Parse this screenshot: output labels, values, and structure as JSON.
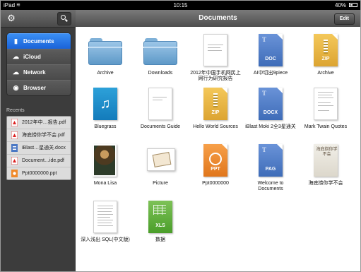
{
  "status_bar": {
    "carrier": "iPad",
    "time": "10:15",
    "battery": "40%"
  },
  "sidebar": {
    "nav": [
      {
        "label": "Documents",
        "icon": "document-icon",
        "active": true
      },
      {
        "label": "iCloud",
        "icon": "cloud-icon",
        "active": false
      },
      {
        "label": "Network",
        "icon": "network-cloud-icon",
        "active": false
      },
      {
        "label": "Browser",
        "icon": "compass-icon",
        "active": false
      }
    ],
    "recents_label": "Recents",
    "recents": [
      {
        "label": "2012年中…报告.pdf",
        "type": "pdf"
      },
      {
        "label": "海底捞你学不会.pdf",
        "type": "pdf"
      },
      {
        "label": "iBlast…星通关.docx",
        "type": "docx"
      },
      {
        "label": "Document…ide.pdf",
        "type": "pdf"
      },
      {
        "label": "Ppt0000000.ppt",
        "type": "ppt"
      }
    ]
  },
  "header": {
    "title": "Documents",
    "edit_label": "Edit"
  },
  "files": [
    {
      "name": "Archive",
      "kind": "folder"
    },
    {
      "name": "Downloads",
      "kind": "folder"
    },
    {
      "name": "2012年中国手机网民上网行为研究报告",
      "kind": "paper"
    },
    {
      "name": "AI中切出9piece",
      "kind": "doc",
      "badge": "DOC",
      "color": "#4a78c4"
    },
    {
      "name": "Archive",
      "kind": "zip",
      "badge": "ZIP",
      "color": "#e6b53a"
    },
    {
      "name": "Bluegrass",
      "kind": "music"
    },
    {
      "name": "Documents Guide",
      "kind": "paper"
    },
    {
      "name": "Hello World Sources",
      "kind": "zip",
      "badge": "ZIP",
      "color": "#e6b53a"
    },
    {
      "name": "iBlast Moki 2全3星通关",
      "kind": "doc",
      "badge": "DOCX",
      "color": "#4a78c4"
    },
    {
      "name": "Mark Twain Quotes",
      "kind": "paper"
    },
    {
      "name": "Mona Lisa",
      "kind": "photo"
    },
    {
      "name": "Picture",
      "kind": "picture"
    },
    {
      "name": "Ppt0000000",
      "kind": "doc",
      "badge": "PPT",
      "color": "#f08a2a"
    },
    {
      "name": "Welcome to Documents",
      "kind": "doc",
      "badge": "PAG",
      "color": "#4a78c4"
    },
    {
      "name": "海底捞你学不会",
      "kind": "book",
      "cover_text": "海底捞你学不会"
    },
    {
      "name": "深入浅出 SQL(中文版)",
      "kind": "paper"
    },
    {
      "name": "数据",
      "kind": "xls",
      "badge": "XLS",
      "color": "#5aaa34"
    }
  ]
}
